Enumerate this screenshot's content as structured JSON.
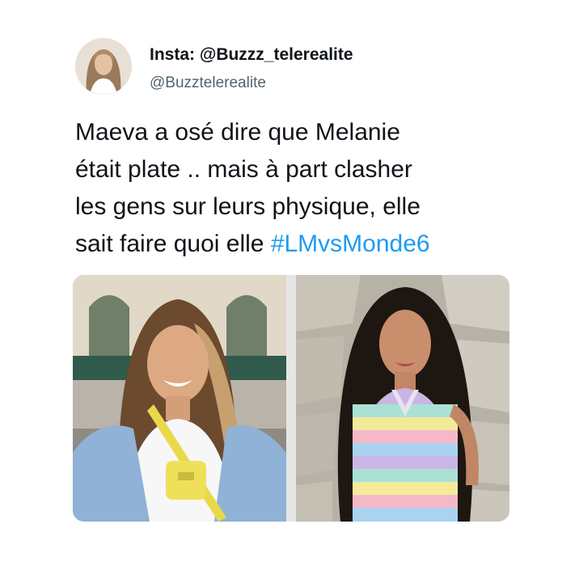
{
  "author": {
    "display_name": "Insta: @Buzzz_telerealite",
    "handle": "@Buzztelerealite",
    "avatar_icon": "profile-avatar"
  },
  "tweet": {
    "text_lines": [
      "Maeva a osé dire que Melanie",
      "était plate .. mais à part clasher",
      "les gens sur leurs physique, elle"
    ],
    "last_line_text": "sait faire quoi elle ",
    "hashtag": "#LMvsMonde6"
  },
  "media": {
    "images": [
      {
        "description_icon": "photo-woman-yellow-bag"
      },
      {
        "description_icon": "photo-woman-striped-top"
      }
    ]
  },
  "colors": {
    "text": "#0f1419",
    "secondary": "#536471",
    "link": "#1d9bf0"
  }
}
